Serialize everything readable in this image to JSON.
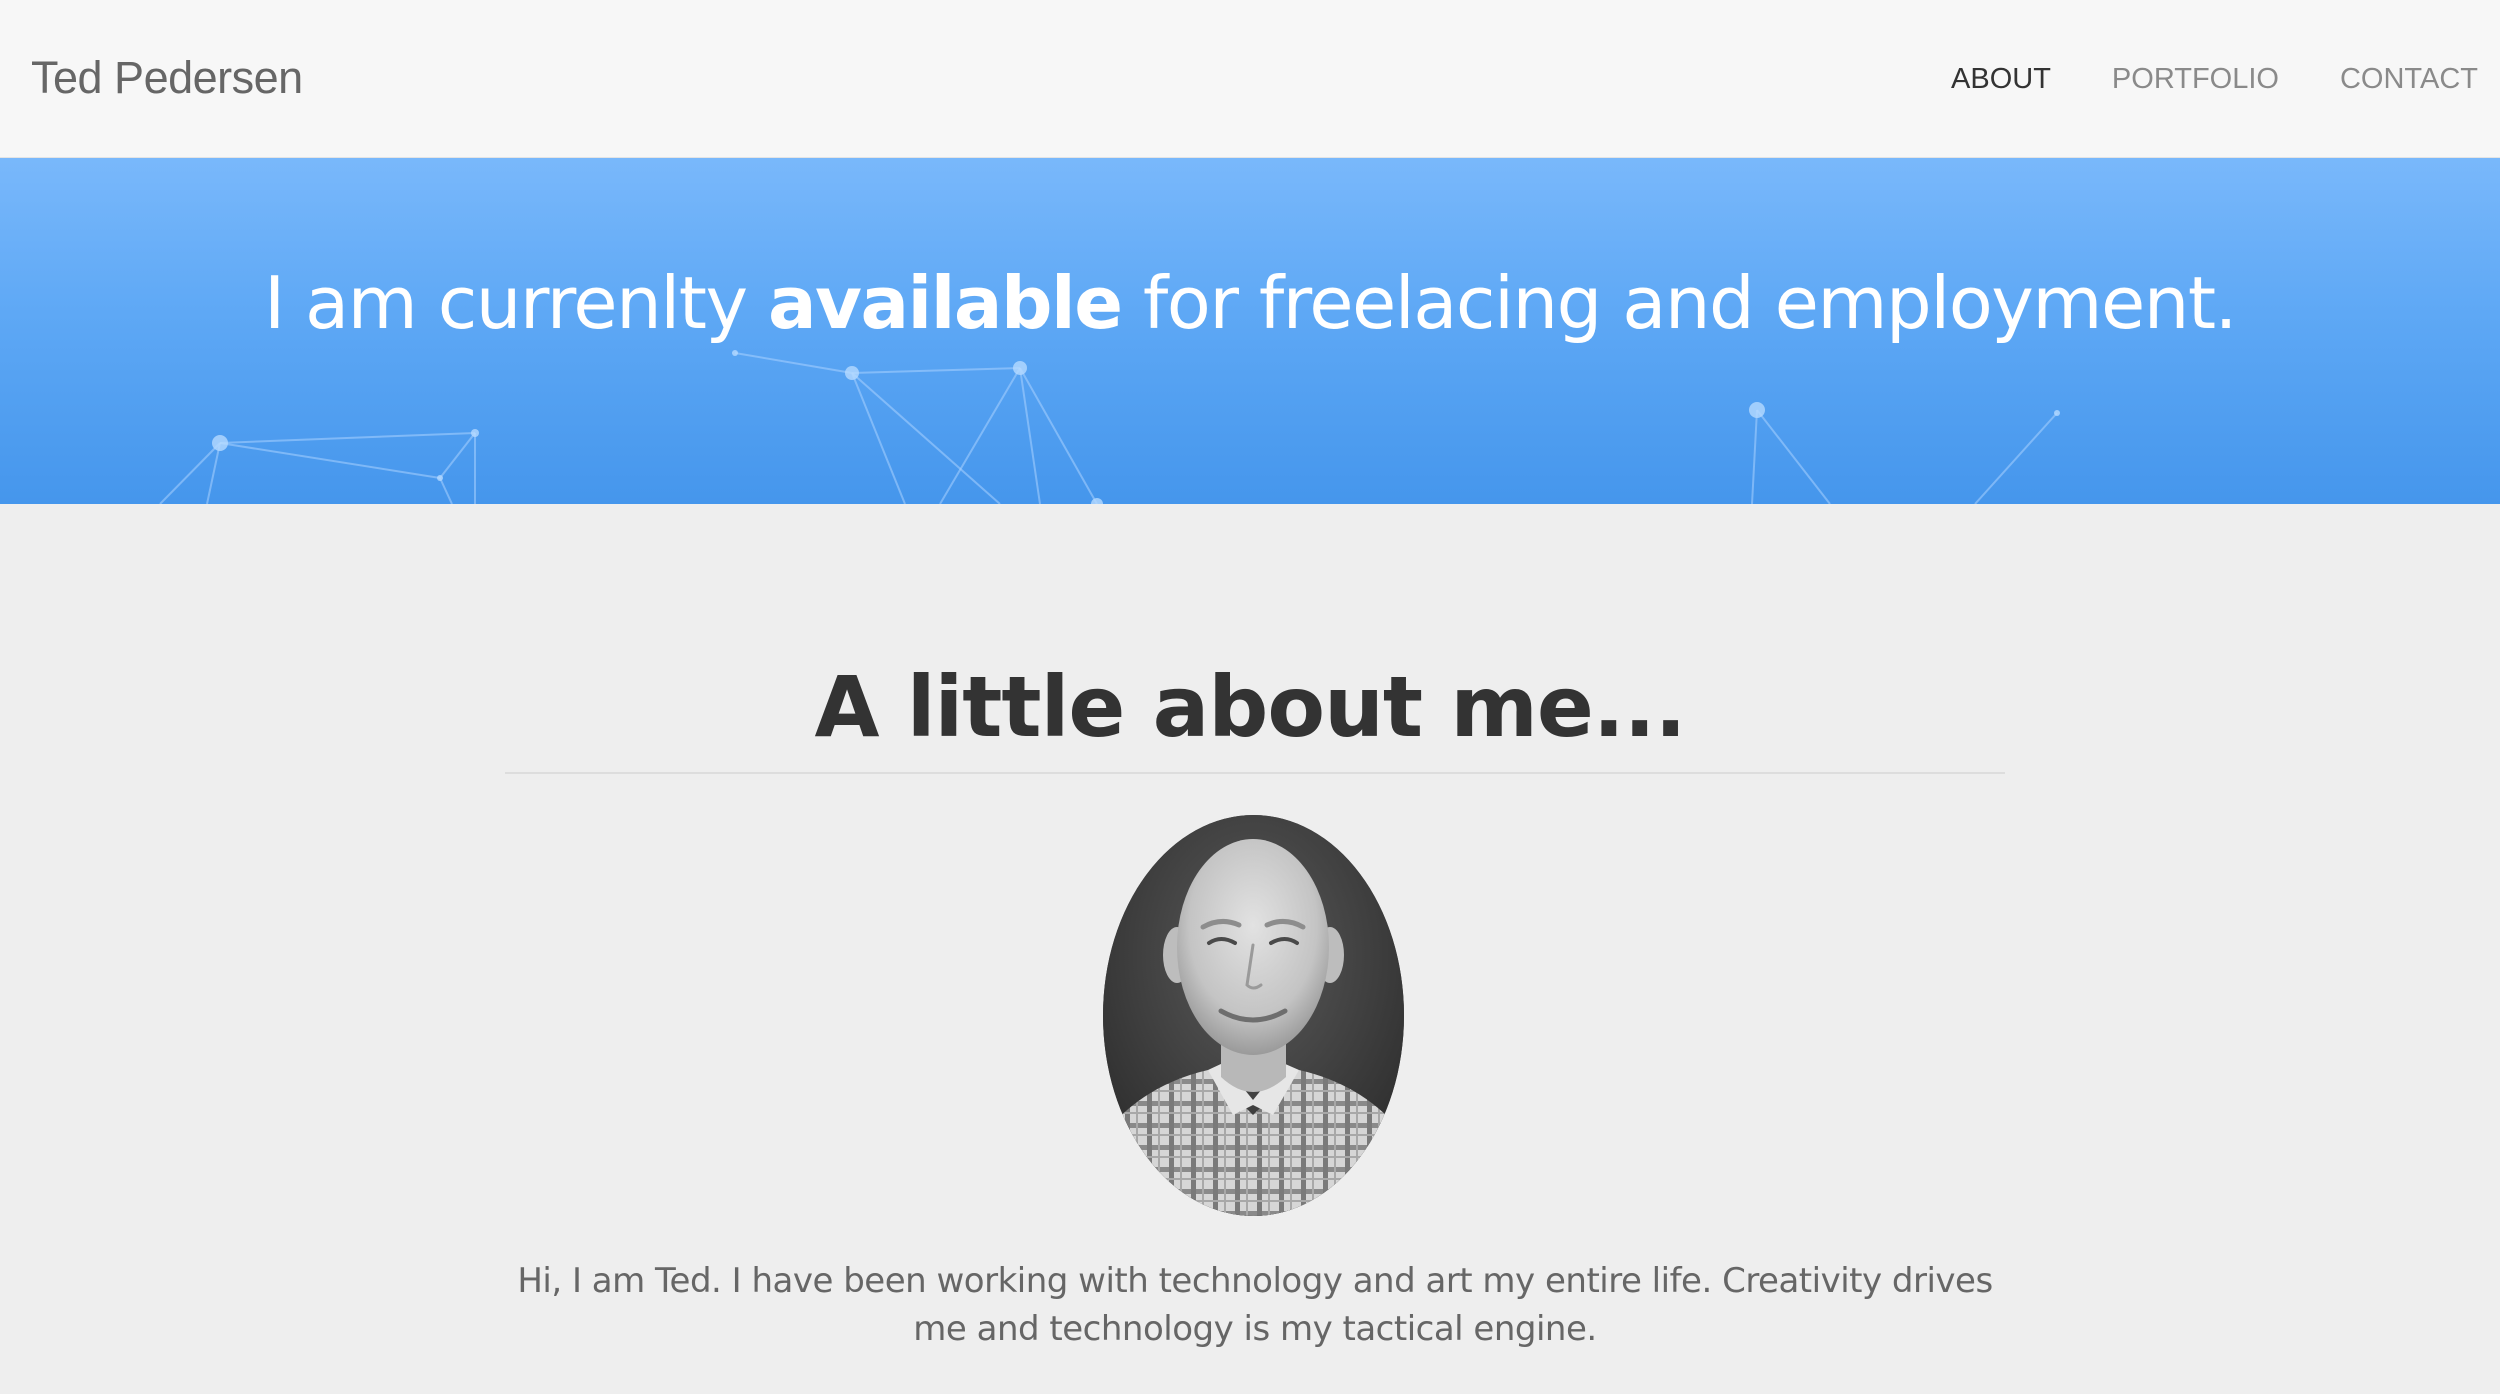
{
  "navbar": {
    "brand": "Ted Pedersen",
    "links": [
      {
        "label": "ABOUT",
        "active": true
      },
      {
        "label": "PORTFOLIO",
        "active": false
      },
      {
        "label": "CONTACT",
        "active": false
      }
    ]
  },
  "hero": {
    "text_before": "I am currenlty ",
    "text_bold": "available",
    "text_after": " for freelacing and employment.",
    "gradient_top": "#79b8fb",
    "gradient_bottom": "#4596ec",
    "decoration": "network-graph"
  },
  "about": {
    "title": "A little about me...",
    "avatar_icon": "portrait-photo",
    "bio": "Hi, I am Ted. I have been working with technology and art my entire life. Creativity drives me and technology is my tactical engine."
  },
  "colors": {
    "page_background": "#eeeeee",
    "navbar_background": "#f7f7f7",
    "active_link": "#333333",
    "inactive_link": "#8a8a8a"
  }
}
